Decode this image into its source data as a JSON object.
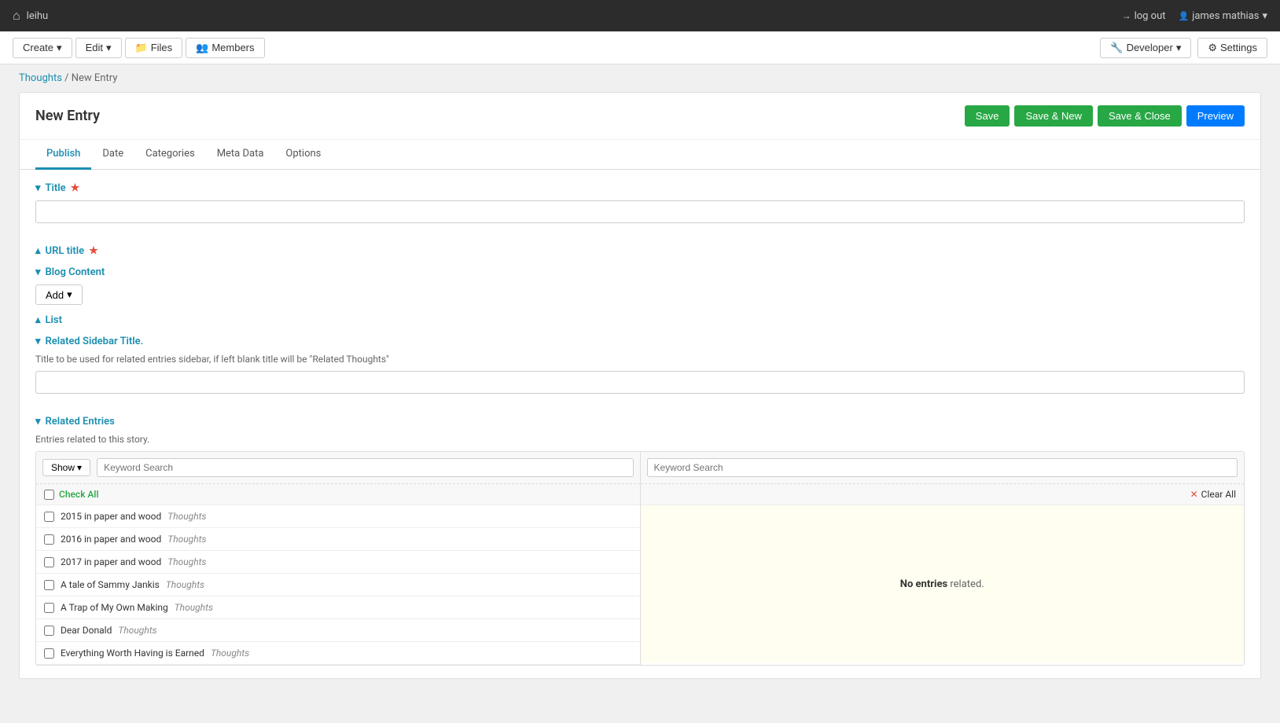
{
  "topNav": {
    "homeIcon": "home",
    "siteName": "leihu",
    "logoutLabel": "log out",
    "userIcon": "user",
    "userName": "james mathias",
    "userDropdown": "▾"
  },
  "secNav": {
    "createLabel": "Create",
    "editLabel": "Edit",
    "filesLabel": "Files",
    "membersLabel": "Members",
    "developerLabel": "Developer",
    "settingsLabel": "Settings"
  },
  "breadcrumb": {
    "channel": "Thoughts",
    "separator": " / ",
    "current": "New Entry"
  },
  "entryHeader": {
    "title": "New Entry",
    "saveLabel": "Save",
    "saveNewLabel": "Save & New",
    "saveCloseLabel": "Save & Close",
    "previewLabel": "Preview"
  },
  "tabs": [
    {
      "id": "publish",
      "label": "Publish",
      "active": true
    },
    {
      "id": "date",
      "label": "Date",
      "active": false
    },
    {
      "id": "categories",
      "label": "Categories",
      "active": false
    },
    {
      "id": "metadata",
      "label": "Meta Data",
      "active": false
    },
    {
      "id": "options",
      "label": "Options",
      "active": false
    }
  ],
  "fields": {
    "titleLabel": "Title",
    "titleRequired": true,
    "urlTitleLabel": "URL title",
    "urlTitleRequired": true,
    "blogContentLabel": "Blog Content",
    "addButtonLabel": "Add",
    "listLabel": "List",
    "relatedSidebarTitleLabel": "Related Sidebar Title.",
    "relatedSidebarTitleDesc": "Title to be used for related entries sidebar, if left blank title will be \"Related Thoughts\"",
    "relatedEntriesLabel": "Related Entries",
    "relatedEntriesDesc": "Entries related to this story."
  },
  "relatedEntries": {
    "showLabel": "Show",
    "leftSearchPlaceholder": "Keyword Search",
    "rightSearchPlaceholder": "Keyword Search",
    "checkAllLabel": "Check All",
    "clearAllLabel": "Clear All",
    "noEntriesText": "No entries related.",
    "noEntriesStrong": "No entries",
    "noEntriesRest": " related.",
    "entries": [
      {
        "id": 1,
        "title": "2015 in paper and wood",
        "tag": "Thoughts"
      },
      {
        "id": 2,
        "title": "2016 in paper and wood",
        "tag": "Thoughts"
      },
      {
        "id": 3,
        "title": "2017 in paper and wood",
        "tag": "Thoughts"
      },
      {
        "id": 4,
        "title": "A tale of Sammy Jankis",
        "tag": "Thoughts"
      },
      {
        "id": 5,
        "title": "A Trap of My Own Making",
        "tag": "Thoughts"
      },
      {
        "id": 6,
        "title": "Dear Donald",
        "tag": "Thoughts"
      },
      {
        "id": 7,
        "title": "Everything Worth Having is Earned",
        "tag": "Thoughts"
      }
    ]
  },
  "colors": {
    "accentBlue": "#1a8eb0",
    "green": "#28a745",
    "red": "#e74c3c"
  }
}
